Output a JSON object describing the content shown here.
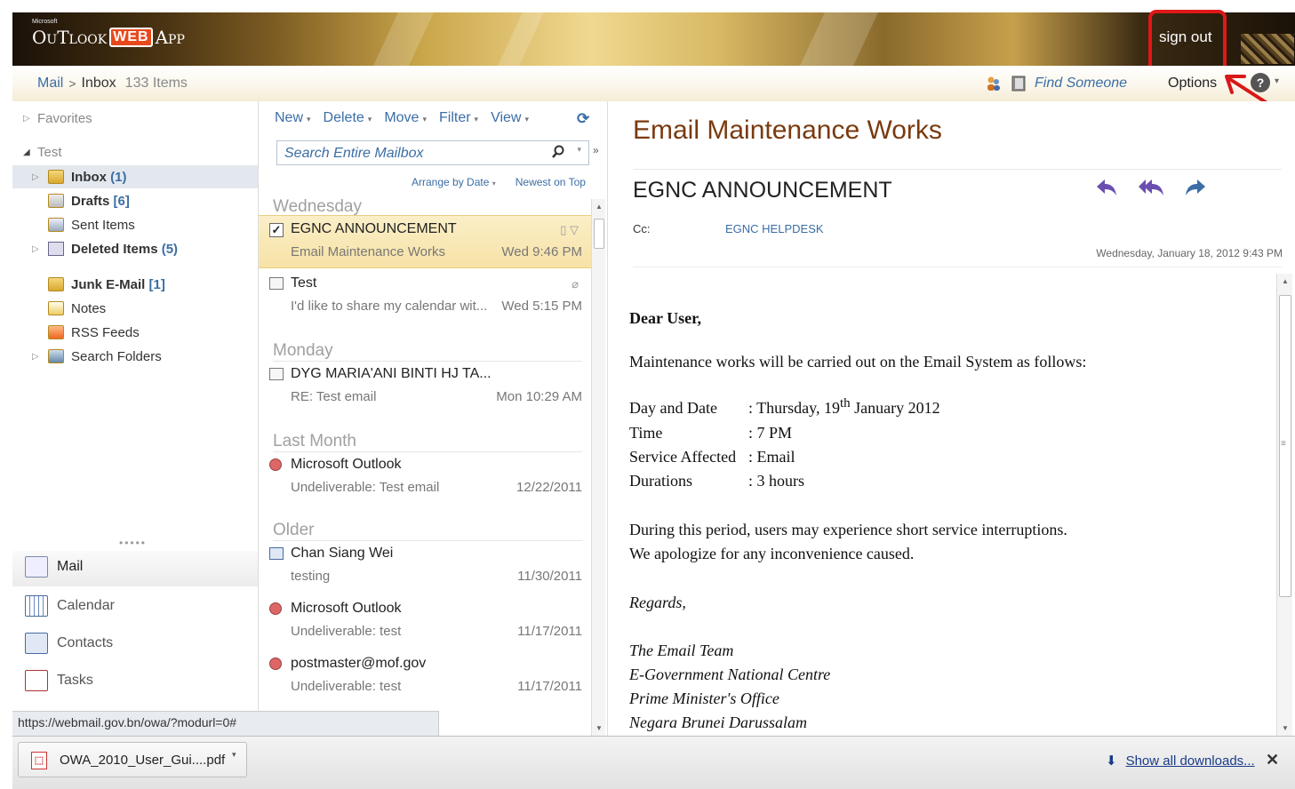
{
  "header": {
    "logo_microsoft": "Microsoft",
    "logo_outlook": "OuTlook",
    "logo_web": "WEB",
    "logo_app": "App",
    "sign_out": "sign out"
  },
  "topbar": {
    "breadcrumb_mail": "Mail",
    "breadcrumb_sep": ">",
    "breadcrumb_inbox": "Inbox",
    "breadcrumb_count": "133 Items",
    "find_someone": "Find Someone",
    "options": "Options",
    "help": "?"
  },
  "nav": {
    "favorites": "Favorites",
    "mailbox": "Test",
    "folders": [
      {
        "label": "Inbox",
        "count": "(1)",
        "bold": true
      },
      {
        "label": "Drafts",
        "count": "[6]",
        "bold": true
      },
      {
        "label": "Sent Items",
        "count": "",
        "bold": false
      },
      {
        "label": "Deleted Items",
        "count": "(5)",
        "bold": true
      },
      {
        "label": "Junk E-Mail",
        "count": "[1]",
        "bold": true
      },
      {
        "label": "Notes",
        "count": "",
        "bold": false
      },
      {
        "label": "RSS Feeds",
        "count": "",
        "bold": false
      },
      {
        "label": "Search Folders",
        "count": "",
        "bold": false
      }
    ],
    "modules": {
      "mail": "Mail",
      "calendar": "Calendar",
      "contacts": "Contacts",
      "tasks": "Tasks"
    },
    "dots": "•••••"
  },
  "status_url": "https://webmail.gov.bn/owa/?modurl=0#",
  "list": {
    "toolbar": {
      "new": "New",
      "delete": "Delete",
      "move": "Move",
      "filter": "Filter",
      "view": "View"
    },
    "search_placeholder": "Search Entire Mailbox",
    "arrange_by": "Arrange by Date",
    "newest_on_top": "Newest on Top",
    "groups": {
      "wednesday": "Wednesday",
      "monday": "Monday",
      "last_month": "Last Month",
      "older": "Older"
    },
    "messages": [
      {
        "from": "EGNC ANNOUNCEMENT",
        "subject": "Email Maintenance Works",
        "date": "Wed 9:46 PM"
      },
      {
        "from": "Test",
        "subject": "I'd like to share my calendar wit...",
        "date": "Wed 5:15 PM"
      },
      {
        "from": "DYG MARIA'ANI BINTI HJ TA...",
        "subject": "RE: Test email",
        "date": "Mon 10:29 AM"
      },
      {
        "from": "Microsoft Outlook",
        "subject": "Undeliverable: Test email",
        "date": "12/22/2011"
      },
      {
        "from": "Chan Siang Wei",
        "subject": "testing",
        "date": "11/30/2011"
      },
      {
        "from": "Microsoft Outlook",
        "subject": "Undeliverable: test",
        "date": "11/17/2011"
      },
      {
        "from": "postmaster@mof.gov",
        "subject": "Undeliverable: test",
        "date": "11/17/2011"
      }
    ]
  },
  "reading": {
    "subject": "Email Maintenance Works",
    "from": "EGNC ANNOUNCEMENT",
    "cc_label": "Cc:",
    "cc_value": "EGNC HELPDESK",
    "sent": "Wednesday, January 18, 2012 9:43 PM",
    "body": {
      "greeting": "Dear User,",
      "intro": "Maintenance works will be carried out on the Email System as follows:",
      "day_label": "Day and Date",
      "day_value": ": Thursday, 19",
      "day_sup": "th",
      "day_rest": " January 2012",
      "time_label": "Time",
      "time_value": ": 7 PM",
      "service_label": "Service Affected",
      "service_value": ": Email",
      "duration_label": "Durations",
      "duration_value": ": 3 hours",
      "line1": "During this period, users may experience short service interruptions.",
      "line2": "We apologize for any inconvenience caused.",
      "regards": "Regards,",
      "sig1": "The Email Team",
      "sig2": "E-Government National Centre",
      "sig3": "Prime Minister's Office",
      "sig4": "Negara Brunei Darussalam"
    }
  },
  "downloads": {
    "filename": "OWA_2010_User_Gui....pdf",
    "show_all": "Show all downloads..."
  },
  "colors": {
    "accent_link": "#3b6ea5",
    "subject_brown": "#7a3a0e",
    "highlight_red": "#e01818",
    "selected_row": "#f7e2a6"
  }
}
